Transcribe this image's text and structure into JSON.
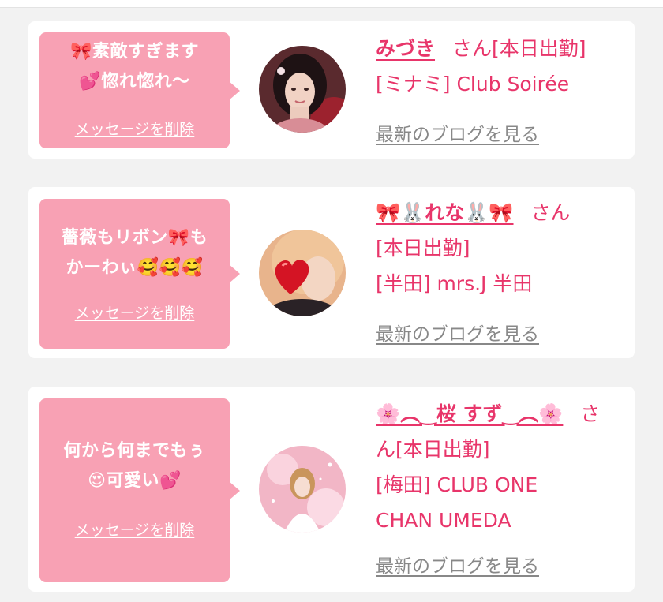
{
  "colors": {
    "accent_pink": "#e8356a",
    "bubble_pink": "#f8a1b4",
    "link_gray": "#888888",
    "background": "#f2f2f2"
  },
  "delete_label": "メッセージを削除",
  "blog_label": "最新のブログを見る",
  "cards": [
    {
      "message_line1": "🎀素敵すぎます",
      "message_line2": "💕惚れ惚れ〜",
      "name": "みづき",
      "honorific": "さん[本日出勤]",
      "shop": "[ミナミ] Club Soirée",
      "avatar_icon": "avatar-woman-dark-hair"
    },
    {
      "message_line1": "薔薇もリボン🎀も",
      "message_line2": "かーわぃ🥰🥰🥰",
      "name": "🎀🐰れな🐰🎀",
      "honorific": "さん",
      "status": "[本日出勤]",
      "shop": "[半田] mrs.J 半田",
      "avatar_icon": "avatar-heart-sticker"
    },
    {
      "message_line1": "何から何までもぅ",
      "message_line2": "😍可愛い💕",
      "name": "🌸︵‿桜 すず‿︵🌸",
      "honorific": "さ",
      "honorific2": "ん[本日出勤]",
      "shop_line1": "[梅田] CLUB ONE",
      "shop_line2": "CHAN UMEDA",
      "avatar_icon": "avatar-pink-sparkle"
    }
  ]
}
